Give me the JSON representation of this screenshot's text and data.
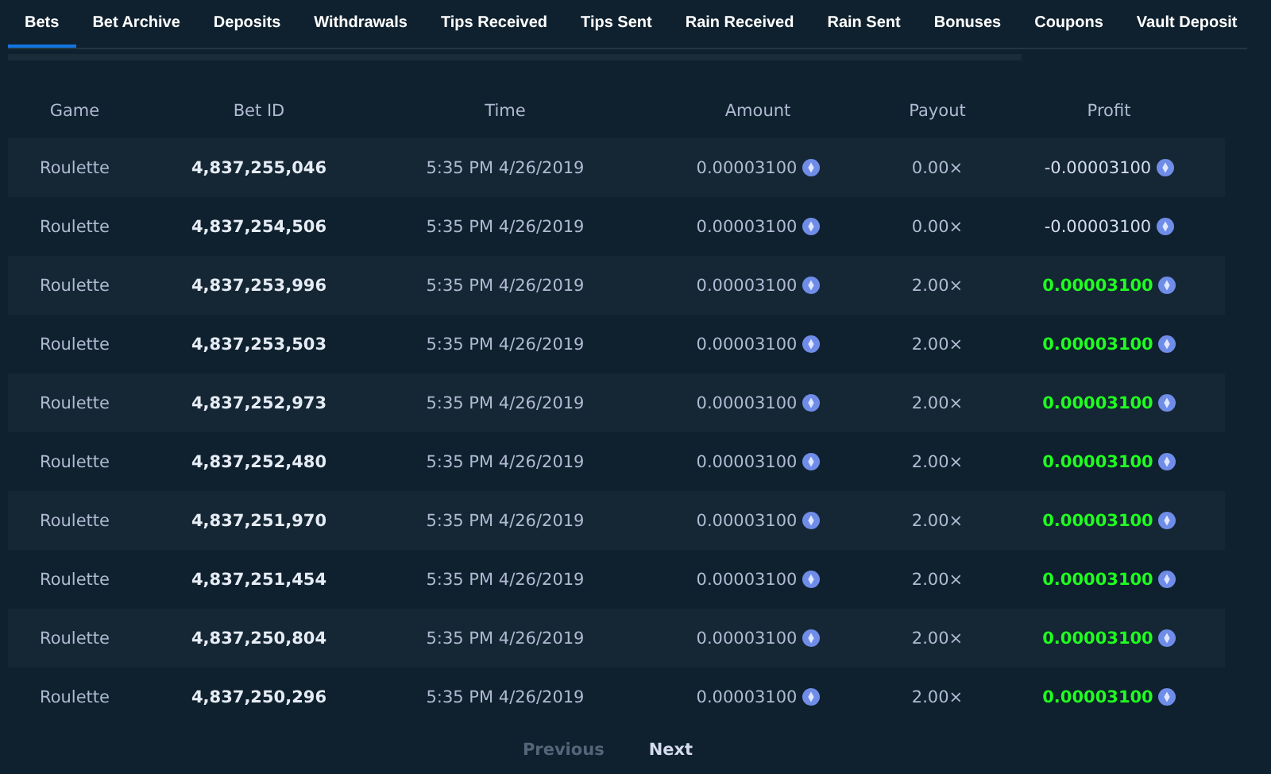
{
  "tabs": [
    {
      "label": "Bets",
      "selected": true
    },
    {
      "label": "Bet Archive",
      "selected": false
    },
    {
      "label": "Deposits",
      "selected": false
    },
    {
      "label": "Withdrawals",
      "selected": false
    },
    {
      "label": "Tips Received",
      "selected": false
    },
    {
      "label": "Tips Sent",
      "selected": false
    },
    {
      "label": "Rain Received",
      "selected": false
    },
    {
      "label": "Rain Sent",
      "selected": false
    },
    {
      "label": "Bonuses",
      "selected": false
    },
    {
      "label": "Coupons",
      "selected": false
    },
    {
      "label": "Vault Deposit",
      "selected": false
    }
  ],
  "table": {
    "columns": [
      "Game",
      "Bet ID",
      "Time",
      "Amount",
      "Payout",
      "Profit"
    ],
    "rows": [
      {
        "game": "Roulette",
        "bet_id": "4,837,255,046",
        "time": "5:35 PM 4/26/2019",
        "amount": "0.00003100",
        "payout": "0.00×",
        "profit": "-0.00003100",
        "win": false
      },
      {
        "game": "Roulette",
        "bet_id": "4,837,254,506",
        "time": "5:35 PM 4/26/2019",
        "amount": "0.00003100",
        "payout": "0.00×",
        "profit": "-0.00003100",
        "win": false
      },
      {
        "game": "Roulette",
        "bet_id": "4,837,253,996",
        "time": "5:35 PM 4/26/2019",
        "amount": "0.00003100",
        "payout": "2.00×",
        "profit": "0.00003100",
        "win": true
      },
      {
        "game": "Roulette",
        "bet_id": "4,837,253,503",
        "time": "5:35 PM 4/26/2019",
        "amount": "0.00003100",
        "payout": "2.00×",
        "profit": "0.00003100",
        "win": true
      },
      {
        "game": "Roulette",
        "bet_id": "4,837,252,973",
        "time": "5:35 PM 4/26/2019",
        "amount": "0.00003100",
        "payout": "2.00×",
        "profit": "0.00003100",
        "win": true
      },
      {
        "game": "Roulette",
        "bet_id": "4,837,252,480",
        "time": "5:35 PM 4/26/2019",
        "amount": "0.00003100",
        "payout": "2.00×",
        "profit": "0.00003100",
        "win": true
      },
      {
        "game": "Roulette",
        "bet_id": "4,837,251,970",
        "time": "5:35 PM 4/26/2019",
        "amount": "0.00003100",
        "payout": "2.00×",
        "profit": "0.00003100",
        "win": true
      },
      {
        "game": "Roulette",
        "bet_id": "4,837,251,454",
        "time": "5:35 PM 4/26/2019",
        "amount": "0.00003100",
        "payout": "2.00×",
        "profit": "0.00003100",
        "win": true
      },
      {
        "game": "Roulette",
        "bet_id": "4,837,250,804",
        "time": "5:35 PM 4/26/2019",
        "amount": "0.00003100",
        "payout": "2.00×",
        "profit": "0.00003100",
        "win": true
      },
      {
        "game": "Roulette",
        "bet_id": "4,837,250,296",
        "time": "5:35 PM 4/26/2019",
        "amount": "0.00003100",
        "payout": "2.00×",
        "profit": "0.00003100",
        "win": true
      }
    ]
  },
  "pagination": {
    "previous": {
      "label": "Previous",
      "disabled": true
    },
    "next": {
      "label": "Next",
      "disabled": false
    }
  }
}
